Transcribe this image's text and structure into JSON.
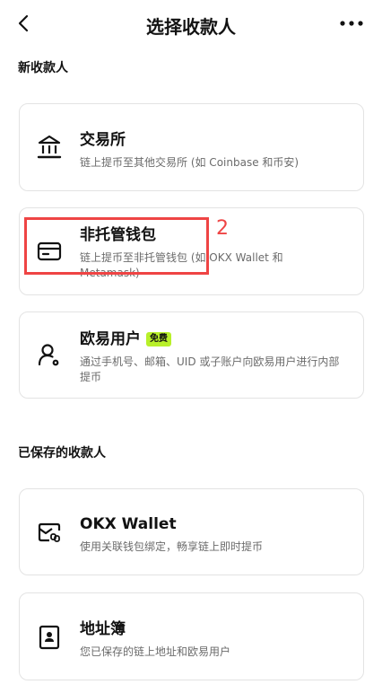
{
  "header": {
    "title": "选择收款人",
    "back_icon": "chevron-left-icon",
    "more_icon": "more-horizontal-icon"
  },
  "sections": {
    "new_payee_label": "新收款人",
    "saved_payee_label": "已保存的收款人"
  },
  "options": {
    "exchange": {
      "icon": "bank-icon",
      "name": "交易所",
      "desc": "链上提币至其他交易所 (如 Coinbase 和币安)"
    },
    "non_custodial": {
      "icon": "wallet-card-icon",
      "name": "非托管钱包",
      "desc": "链上提币至非托管钱包 (如 OKX Wallet 和 Metamask)"
    },
    "okx_user": {
      "icon": "user-settings-icon",
      "name": "欧易用户",
      "badge": "免费",
      "desc": "通过手机号、邮箱、UID 或子账户向欧易用户进行内部提币"
    },
    "okx_wallet": {
      "icon": "linked-wallet-icon",
      "name": "OKX Wallet",
      "desc": "使用关联钱包绑定，畅享链上即时提币"
    },
    "address_book": {
      "icon": "address-book-icon",
      "name": "地址簿",
      "desc": "您已保存的链上地址和欧易用户"
    }
  },
  "annotation": {
    "number": "2"
  },
  "colors": {
    "badge": "#b8f02a",
    "annotation": "#ef4444",
    "border": "#e3e3e3"
  }
}
